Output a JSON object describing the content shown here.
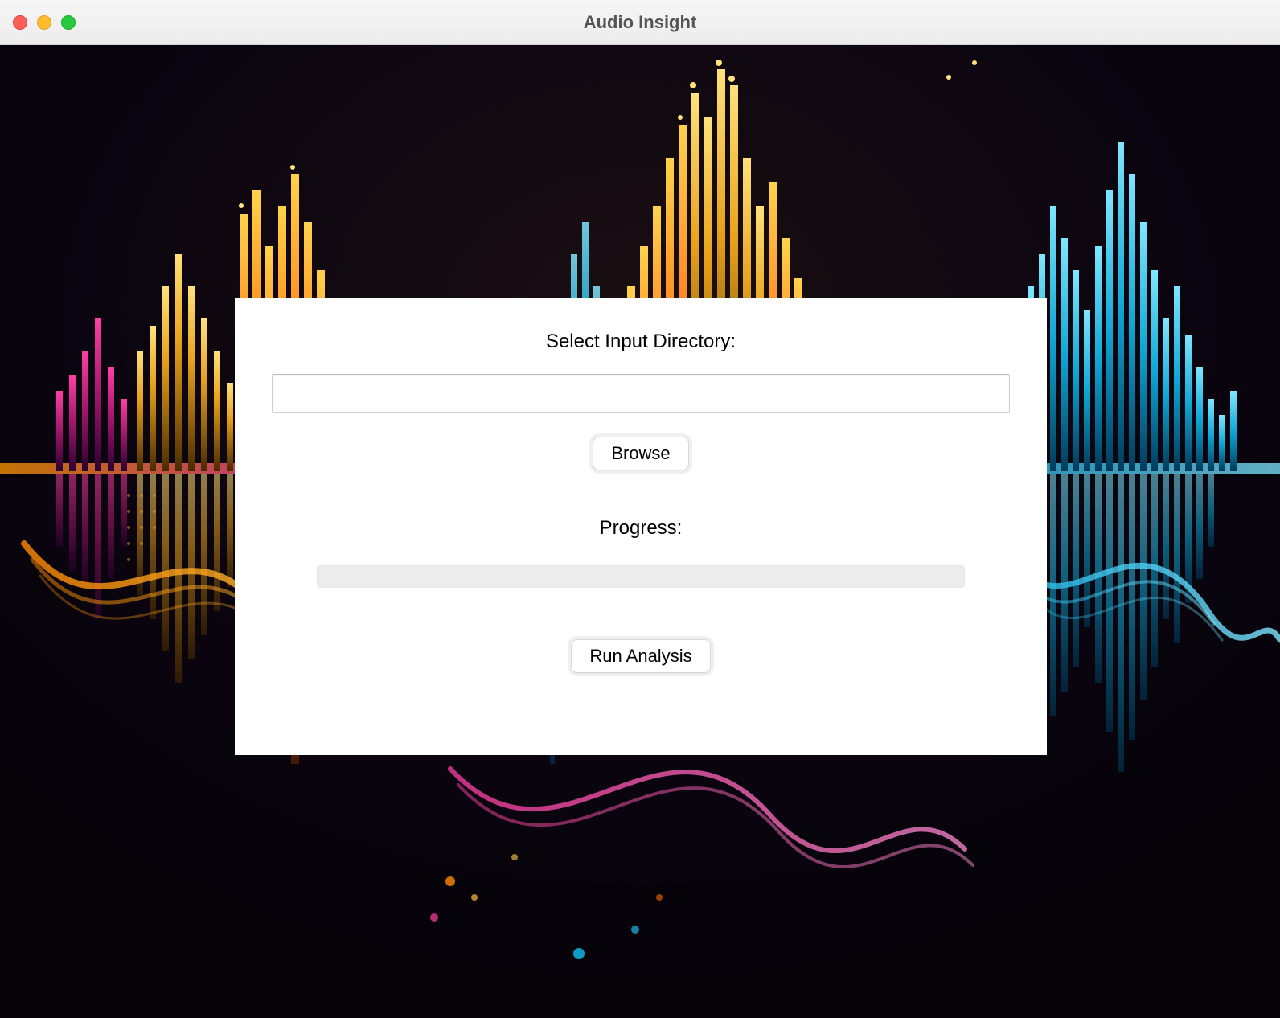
{
  "window": {
    "title": "Audio Insight"
  },
  "panel": {
    "select_label": "Select Input Directory:",
    "directory_value": "",
    "browse_label": "Browse",
    "progress_label": "Progress:",
    "progress_percent": 0,
    "run_label": "Run Analysis"
  }
}
